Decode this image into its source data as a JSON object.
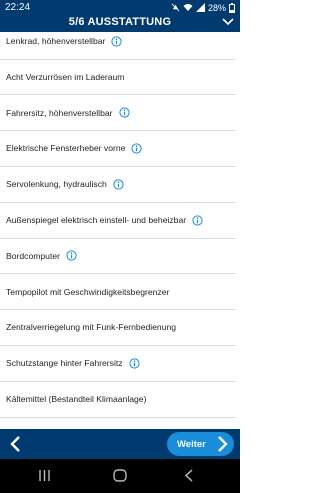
{
  "status_bar": {
    "time": "22:24",
    "battery": "28%"
  },
  "header": {
    "title": "5/6 AUSSTATTUNG"
  },
  "items": [
    {
      "label": "Lenkrad, höhenverstellbar",
      "info": true
    },
    {
      "label": "Acht Verzurrösen im Laderaum",
      "info": false
    },
    {
      "label": "Fahrersitz, höhenverstellbar",
      "info": true
    },
    {
      "label": "Elektrische Fensterheber vorne",
      "info": true
    },
    {
      "label": "Servolenkung, hydraulisch",
      "info": true
    },
    {
      "label": "Außenspiegel elektrisch einstell- und beheizbar",
      "info": true
    },
    {
      "label": "Bordcomputer",
      "info": true
    },
    {
      "label": "Tempopilot mit Geschwindigkeitsbegrenzer",
      "info": false
    },
    {
      "label": "Zentralverriegelung mit Funk-Fernbedienung",
      "info": false
    },
    {
      "label": "Schutzstange hinter Fahrersitz",
      "info": true
    },
    {
      "label": "Kältemittel (Bestandteil Klimaanlage)",
      "info": false
    }
  ],
  "footer": {
    "next_label": "Weiter"
  },
  "colors": {
    "header_bg": "#003a6e",
    "accent": "#1a8cd8"
  },
  "icons": [
    "info-icon",
    "back-chevron-icon",
    "forward-arrow-icon",
    "chevron-down-icon"
  ]
}
